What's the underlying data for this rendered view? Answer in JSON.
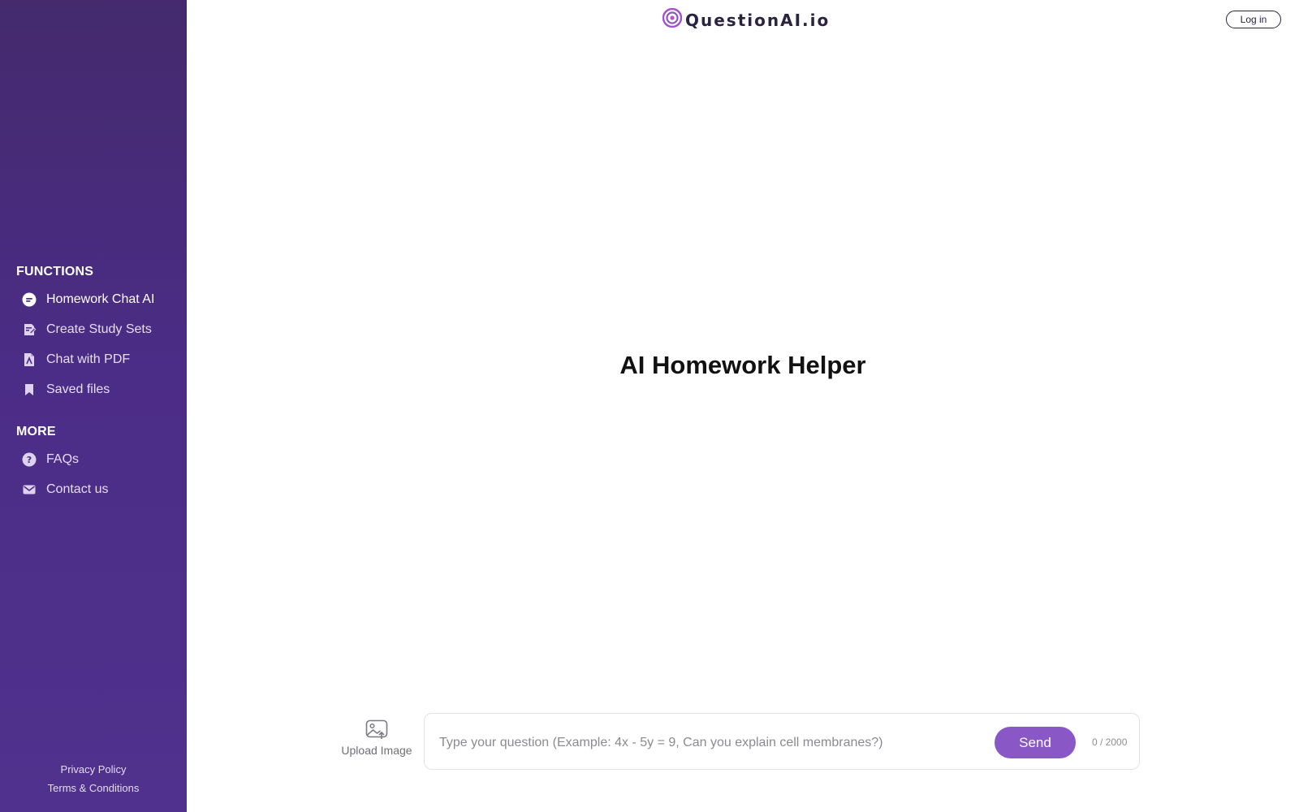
{
  "brand": {
    "name": "QuestionAI.io"
  },
  "header": {
    "login_label": "Log in"
  },
  "sidebar": {
    "functions_title": "FUNCTIONS",
    "functions": [
      {
        "label": "Homework Chat AI",
        "icon": "chat-icon",
        "active": true
      },
      {
        "label": "Create Study Sets",
        "icon": "study-sets-icon"
      },
      {
        "label": "Chat with PDF",
        "icon": "pdf-icon"
      },
      {
        "label": "Saved files",
        "icon": "bookmark-icon"
      }
    ],
    "more_title": "MORE",
    "more": [
      {
        "label": "FAQs",
        "icon": "question-icon"
      },
      {
        "label": "Contact us",
        "icon": "mail-icon"
      }
    ],
    "footer": {
      "privacy": "Privacy Policy",
      "terms": "Terms & Conditions"
    }
  },
  "main": {
    "title": "AI Homework Helper",
    "upload_label": "Upload Image",
    "question_placeholder": "Type your question (Example: 4x - 5y = 9, Can you explain cell membranes?)",
    "question_value": "",
    "send_label": "Send",
    "char_count": "0 / 2000"
  },
  "colors": {
    "sidebar_top": "#442a6d",
    "sidebar_bottom": "#50328e",
    "accent": "#8a57c6"
  }
}
